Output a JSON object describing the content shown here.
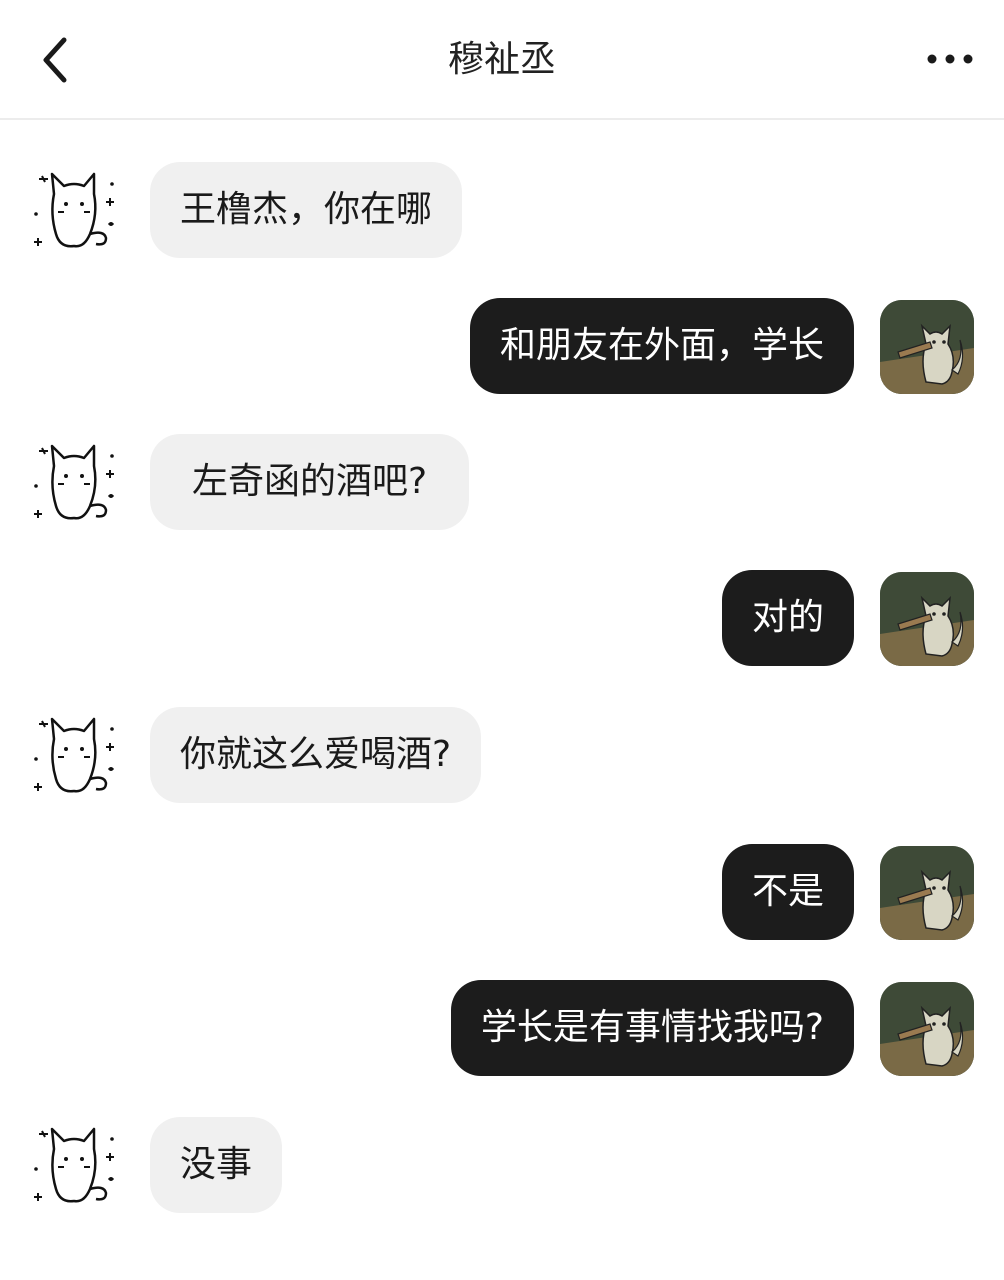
{
  "header": {
    "title": "穆祉丞"
  },
  "icons": {
    "back": "chevron-left-icon",
    "more": "more-horizontal-icon",
    "contact_avatar": "doodle-cat-avatar",
    "self_avatar": "cartoon-cat-avatar"
  },
  "colors": {
    "incoming_bubble": "#f0f0f0",
    "outgoing_bubble": "#1c1c1c",
    "background": "#ffffff"
  },
  "messages": [
    {
      "side": "in",
      "text": "王橹杰，你在哪"
    },
    {
      "side": "out",
      "text": "和朋友在外面，学长"
    },
    {
      "side": "in",
      "text": "左奇函的酒吧?"
    },
    {
      "side": "out",
      "text": "对的"
    },
    {
      "side": "in",
      "text": "你就这么爱喝酒?"
    },
    {
      "side": "out",
      "text": "不是"
    },
    {
      "side": "out",
      "text": "学长是有事情找我吗?"
    },
    {
      "side": "in",
      "text": "没事"
    }
  ]
}
